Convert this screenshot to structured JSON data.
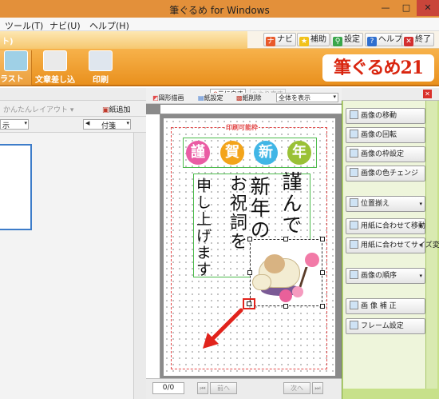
{
  "window": {
    "title": "筆ぐるめ for Windows",
    "min_glyph": "—",
    "max_glyph": "□",
    "close_glyph": "✕"
  },
  "menu": [
    "ツール(T)",
    "ナビ(U)",
    "ヘルプ(H)"
  ],
  "toolbar": {
    "tab_fragment": "ト)",
    "navi": "ナビ",
    "hojo": "補助",
    "settei": "設定",
    "help": "ヘルプ",
    "exit": "終了"
  },
  "ribbon": {
    "illust": "ラスト",
    "text_insert": "文章差し込み",
    "print": "印刷",
    "logo": "筆ぐるめ21"
  },
  "left_panel": {
    "layout_button": "かんたんレイアウト",
    "add_paper": "紙追加",
    "display_fragment": "示",
    "attach_label": "付箋"
  },
  "canvas_toolbar": {
    "undo": "元に戻す",
    "redo": "やり直す",
    "shape": "図形描画",
    "paper_settings": "紙設定",
    "paper_delete": "紙削除",
    "zoom": "全体を表示"
  },
  "card": {
    "print_area_label": "印刷可能枠",
    "nenga": [
      "謹",
      "賀",
      "新",
      "年"
    ],
    "message_cols": [
      "謹んで",
      "新年の",
      "お祝詞を",
      "申し上げます"
    ]
  },
  "pager": {
    "page_count": "0/0",
    "prev": "前へ",
    "next": "次へ"
  },
  "right_panel": {
    "buttons": [
      {
        "label": "画像の移動",
        "dropdown": false
      },
      {
        "label": "画像の回転",
        "dropdown": false
      },
      {
        "label": "画像の枠設定",
        "dropdown": false
      },
      {
        "label": "画像の色チェンジ",
        "dropdown": false
      },
      {
        "label": "位置揃え",
        "dropdown": true
      },
      {
        "label": "用紙に合わせて移動",
        "dropdown": true
      },
      {
        "label": "用紙に合わせてサイズ変更",
        "dropdown": true
      },
      {
        "label": "画像の順序",
        "dropdown": true
      },
      {
        "label": "画 像 補 正",
        "dropdown": false
      },
      {
        "label": "フレーム設定",
        "dropdown": false
      }
    ],
    "close_glyph": "✕"
  },
  "colors": {
    "ribbon_orange": "#f0a035",
    "right_panel_green": "#c7e18a",
    "print_border_red": "#e24b4b",
    "annotation_red": "#e1231c"
  }
}
